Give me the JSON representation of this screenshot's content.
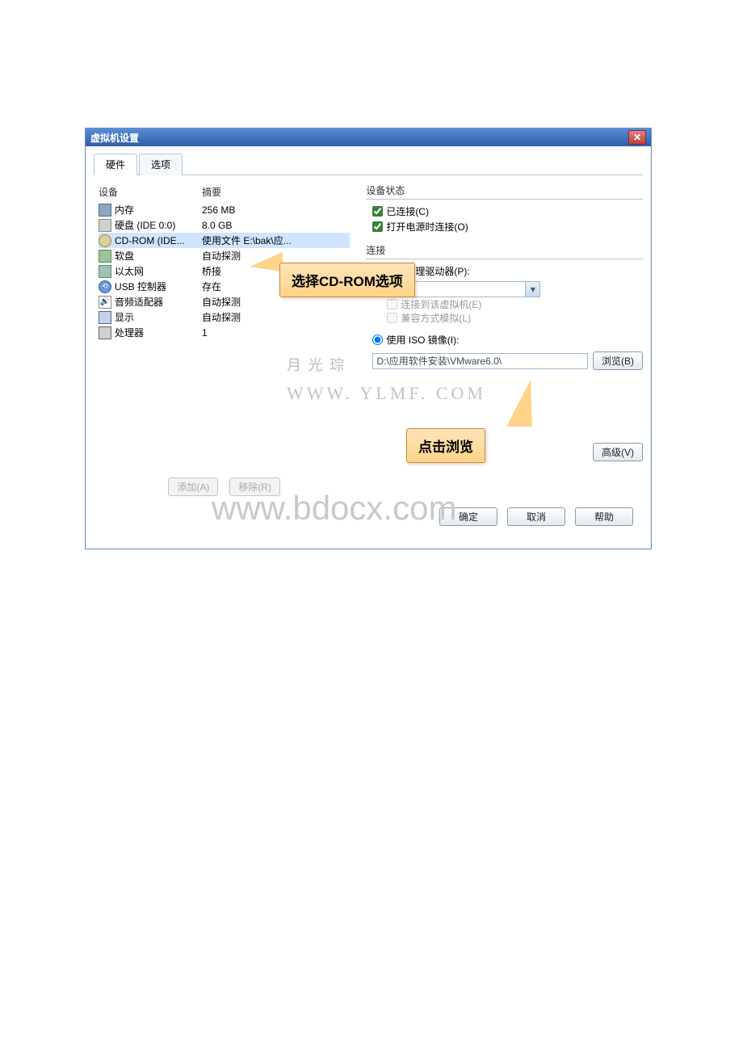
{
  "title": "虚拟机设置",
  "tabs": {
    "hardware": "硬件",
    "options": "选项"
  },
  "headers": {
    "device": "设备",
    "summary": "摘要"
  },
  "devices": [
    {
      "icon": "mem",
      "label": "内存",
      "summary": "256 MB"
    },
    {
      "icon": "disk",
      "label": "硬盘 (IDE 0:0)",
      "summary": "8.0 GB"
    },
    {
      "icon": "cd",
      "label": "CD-ROM (IDE...",
      "summary": "使用文件 E:\\bak\\应..."
    },
    {
      "icon": "floppy",
      "label": "软盘",
      "summary": "自动探测"
    },
    {
      "icon": "net",
      "label": "以太网",
      "summary": "桥接"
    },
    {
      "icon": "usb",
      "label": "USB 控制器",
      "summary": "存在"
    },
    {
      "icon": "audio",
      "label": "音频适配器",
      "summary": "自动探测"
    },
    {
      "icon": "display",
      "label": "显示",
      "summary": "自动探测"
    },
    {
      "icon": "cpu",
      "label": "处理器",
      "summary": "1"
    }
  ],
  "device_status": {
    "title": "设备状态",
    "connected": "已连接(C)",
    "power_on": "打开电源时连接(O)"
  },
  "connection": {
    "title": "连接",
    "physical": "使用物理驱动器(P):",
    "direct": "连接到该虚拟机(E)",
    "legacy": "兼容方式模拟(L)",
    "use_iso": "使用 ISO 镜像(I):",
    "iso_path": "D:\\应用软件安装\\VMware6.0\\",
    "browse": "浏览(B)"
  },
  "buttons": {
    "add": "添加(A)",
    "remove": "移除(R)",
    "advanced": "高级(V)",
    "ok": "确定",
    "cancel": "取消",
    "help": "帮助"
  },
  "callouts": {
    "select_cdrom": "选择CD-ROM选项",
    "click_browse": "点击浏览"
  },
  "watermarks": {
    "site": "WWW. YLMF. COM",
    "big": "www.bdocx.com"
  }
}
